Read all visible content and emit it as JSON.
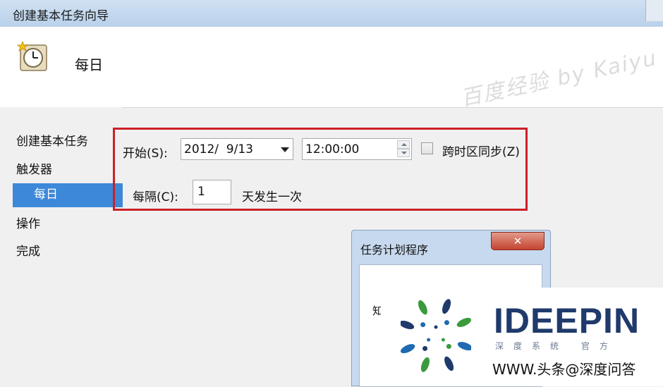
{
  "window": {
    "title": "创建基本任务向导"
  },
  "header": {
    "title": "每日",
    "watermark": "百度经验 by Kaiyu"
  },
  "nav": {
    "items": [
      {
        "label": "创建基本任务"
      },
      {
        "label": "触发器"
      },
      {
        "label": "每日"
      },
      {
        "label": "操作"
      },
      {
        "label": "完成"
      }
    ]
  },
  "form": {
    "start_label": "开始(S):",
    "date_value": "2012/  9/13",
    "time_value": "12:00:00",
    "sync_label": "跨时区同步(Z)",
    "sync_checked": false,
    "recur_label": "每隔(C):",
    "recur_value": "1",
    "recur_suffix": "天发生一次"
  },
  "dialog": {
    "title": "任务计划程序",
    "close_label": "✕",
    "body_fragment": "知"
  },
  "overlay": {
    "brand": "IDEEPIN",
    "brand_sub": "深度系统 官方",
    "caption": "WWW.头条@深度问答"
  },
  "colors": {
    "highlight": "#cc2027",
    "selected_nav": "#3d88d8",
    "brand": "#1f3a6b"
  }
}
